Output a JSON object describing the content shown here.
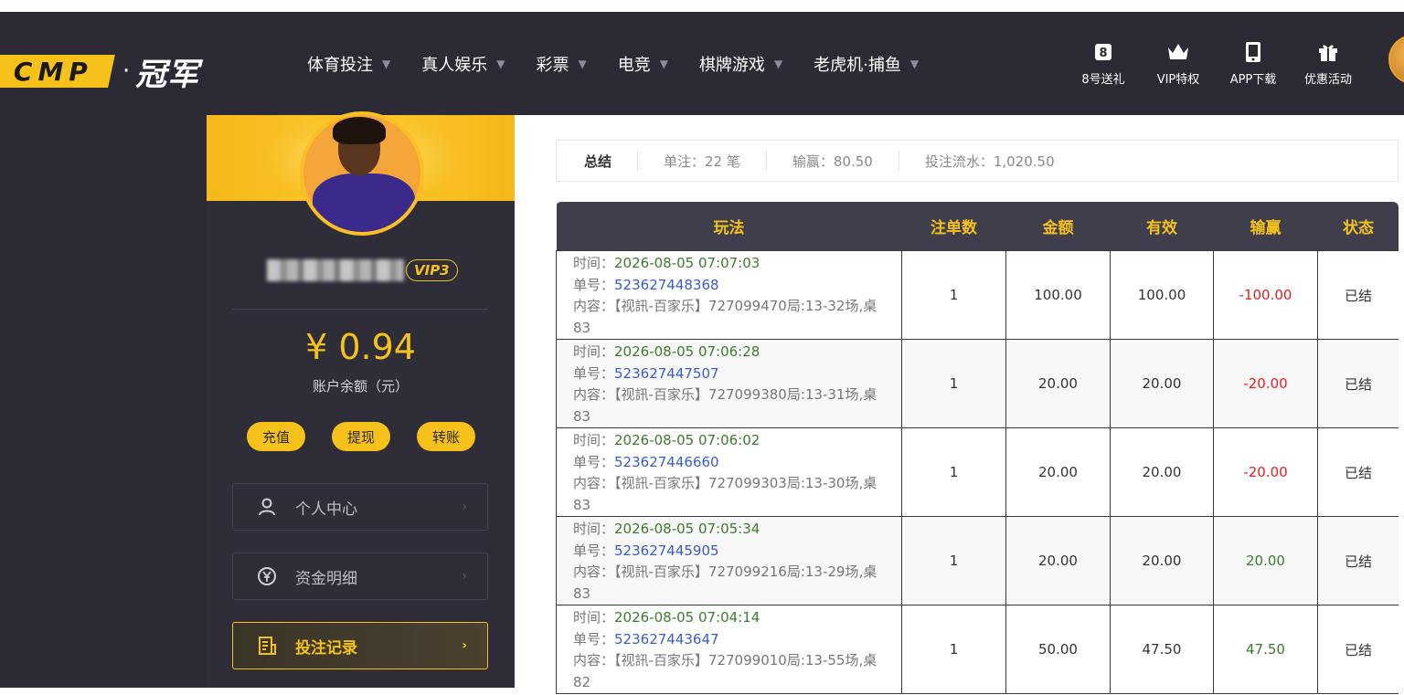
{
  "header": {
    "logo_box_text": "CMP",
    "logo_text": "冠军",
    "nav": [
      {
        "label": "体育投注"
      },
      {
        "label": "真人娱乐"
      },
      {
        "label": "彩票"
      },
      {
        "label": "电竞"
      },
      {
        "label": "棋牌游戏"
      },
      {
        "label": "老虎机·捕鱼"
      }
    ],
    "actions": [
      {
        "label": "8号送礼",
        "icon": "gift-box-icon"
      },
      {
        "label": "VIP特权",
        "icon": "crown-icon"
      },
      {
        "label": "APP下载",
        "icon": "phone-icon"
      },
      {
        "label": "优惠活动",
        "icon": "present-icon"
      }
    ]
  },
  "sidebar": {
    "vip_level": "VIP3",
    "balance": "¥ 0.94",
    "balance_label": "账户余额（元）",
    "buttons": {
      "deposit": "充值",
      "withdraw": "提现",
      "transfer": "转账"
    },
    "menu": [
      {
        "label": "个人中心",
        "icon": "user-icon"
      },
      {
        "label": "资金明细",
        "icon": "yuan-coin-icon"
      },
      {
        "label": "投注记录",
        "icon": "record-icon",
        "active": true
      }
    ]
  },
  "summary": {
    "title": "总结",
    "bets": "单注：22 笔",
    "winloss": "输赢：80.50",
    "turnover": "投注流水：1,020.50"
  },
  "table": {
    "columns": [
      "玩法",
      "注单数",
      "金额",
      "有效",
      "输赢",
      "状态"
    ],
    "labels": {
      "time": "时间：",
      "order": "单号：",
      "content": "内容："
    },
    "rows": [
      {
        "time": "2026-08-05 07:07:03",
        "order": "523627448368",
        "content": "【视訊-百家乐】727099470局:13-32场,桌83",
        "count": "1",
        "amount": "100.00",
        "valid": "100.00",
        "winloss": "-100.00",
        "status": "已结"
      },
      {
        "time": "2026-08-05 07:06:28",
        "order": "523627447507",
        "content": "【视訊-百家乐】727099380局:13-31场,桌83",
        "count": "1",
        "amount": "20.00",
        "valid": "20.00",
        "winloss": "-20.00",
        "status": "已结"
      },
      {
        "time": "2026-08-05 07:06:02",
        "order": "523627446660",
        "content": "【视訊-百家乐】727099303局:13-30场,桌83",
        "count": "1",
        "amount": "20.00",
        "valid": "20.00",
        "winloss": "-20.00",
        "status": "已结"
      },
      {
        "time": "2026-08-05 07:05:34",
        "order": "523627445905",
        "content": "【视訊-百家乐】727099216局:13-29场,桌83",
        "count": "1",
        "amount": "20.00",
        "valid": "20.00",
        "winloss": "20.00",
        "status": "已结"
      },
      {
        "time": "2026-08-05 07:04:14",
        "order": "523627443647",
        "content": "【视訊-百家乐】727099010局:13-55场,桌82",
        "count": "1",
        "amount": "50.00",
        "valid": "47.50",
        "winloss": "47.50",
        "status": "已结"
      }
    ]
  },
  "colors": {
    "accent": "#f6c11a",
    "header_bg": "#2b2a35",
    "loss": "#e02020",
    "win": "#3d7a2e",
    "link": "#3a5cc7"
  }
}
